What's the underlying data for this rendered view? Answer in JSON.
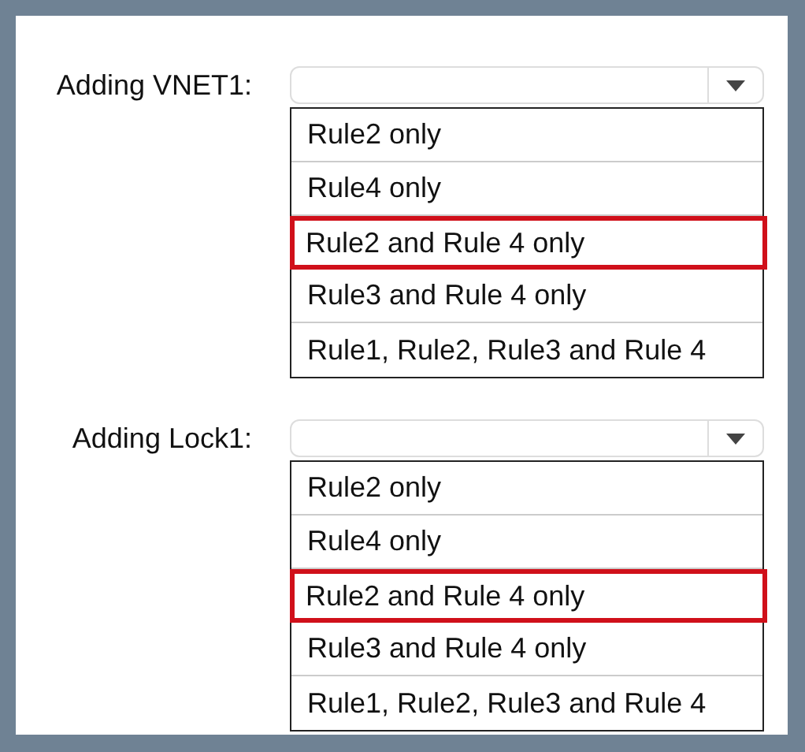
{
  "dropdowns": [
    {
      "label": "Adding VNET1:",
      "options": [
        {
          "text": "Rule2 only",
          "selected": false
        },
        {
          "text": "Rule4 only",
          "selected": false
        },
        {
          "text": "Rule2 and Rule 4 only",
          "selected": true
        },
        {
          "text": "Rule3 and Rule 4 only",
          "selected": false
        },
        {
          "text": "Rule1, Rule2, Rule3 and Rule 4",
          "selected": false
        }
      ]
    },
    {
      "label": "Adding Lock1:",
      "options": [
        {
          "text": "Rule2 only",
          "selected": false
        },
        {
          "text": "Rule4 only",
          "selected": false
        },
        {
          "text": "Rule2 and Rule 4 only",
          "selected": true
        },
        {
          "text": "Rule3 and Rule 4 only",
          "selected": false
        },
        {
          "text": "Rule1, Rule2, Rule3 and Rule 4",
          "selected": false
        }
      ]
    }
  ]
}
